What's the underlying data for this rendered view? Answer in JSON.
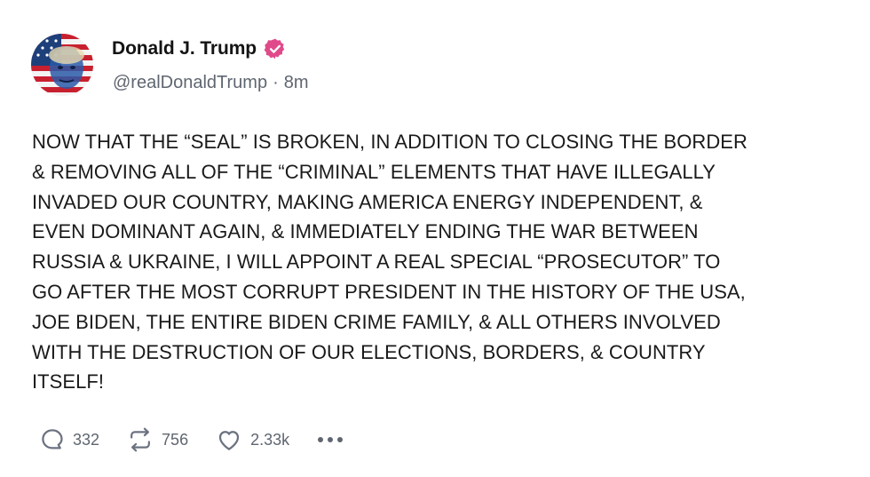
{
  "author": {
    "display_name": "Donald J. Trump",
    "handle": "@realDonaldTrump",
    "separator": "·",
    "timestamp": "8m",
    "verified_color": "#e04a8b"
  },
  "post": {
    "text": "NOW THAT THE “SEAL” IS BROKEN, IN ADDITION TO CLOSING THE BORDER\n& REMOVING ALL OF THE “CRIMINAL” ELEMENTS THAT HAVE ILLEGALLY\nINVADED OUR COUNTRY, MAKING AMERICA ENERGY INDEPENDENT, &\nEVEN DOMINANT AGAIN, & IMMEDIATELY ENDING THE WAR BETWEEN\nRUSSIA & UKRAINE, I WILL APPOINT A REAL SPECIAL “PROSECUTOR” TO\nGO AFTER THE MOST CORRUPT PRESIDENT IN THE HISTORY OF THE USA,\nJOE BIDEN, THE ENTIRE BIDEN CRIME FAMILY, & ALL OTHERS INVOLVED\nWITH THE DESTRUCTION OF OUR ELECTIONS, BORDERS, & COUNTRY\nITSELF!"
  },
  "actions": {
    "replies": {
      "icon": "reply-icon",
      "count": "332"
    },
    "retruths": {
      "icon": "repost-icon",
      "count": "756"
    },
    "likes": {
      "icon": "heart-icon",
      "count": "2.33k"
    },
    "more": {
      "icon": "more-icon"
    }
  },
  "colors": {
    "text": "#1a1a1a",
    "secondary": "#5f6670",
    "icon": "#6b7280"
  }
}
